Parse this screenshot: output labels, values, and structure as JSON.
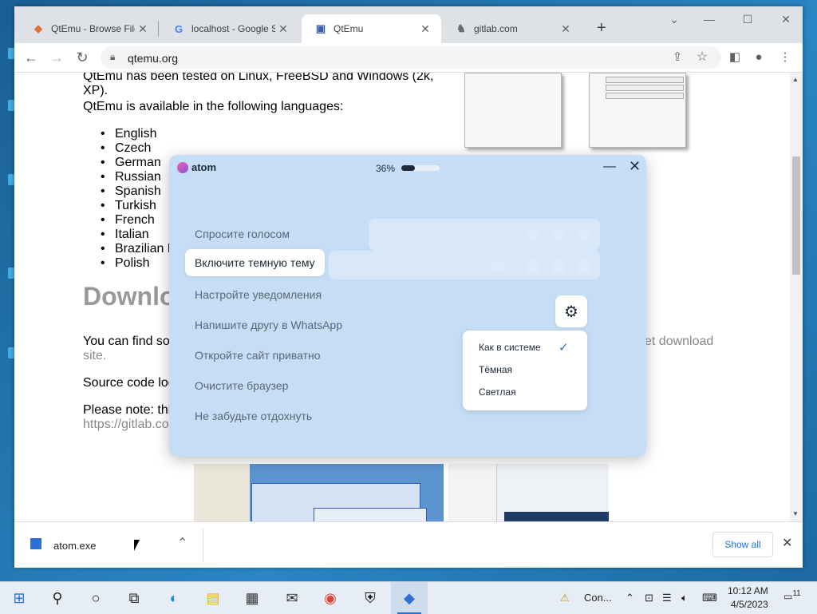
{
  "browser": {
    "tabs": [
      {
        "title": "QtEmu - Browse Files",
        "favicon": "gitlab-diamond-icon"
      },
      {
        "title": "localhost - Google Se",
        "favicon": "google-icon"
      },
      {
        "title": "QtEmu",
        "favicon": "qtemu-icon"
      },
      {
        "title": "gitlab.com",
        "favicon": "gitlab-fox-icon"
      }
    ],
    "url": "qtemu.org"
  },
  "page": {
    "line1": "QtEmu has been tested on Linux, FreeBSD and Windows (2k,",
    "line2": "XP).",
    "line3": "QtEmu is available in the following languages:",
    "languages": [
      "English",
      "Czech",
      "German",
      "Russian",
      "Spanish",
      "Turkish",
      "French",
      "Italian",
      "Brazilian P",
      "Polish"
    ],
    "heading": "Downlo",
    "para1a": "You can find so",
    "para1b": "et download",
    "para1c": "site.",
    "para2": "Source code loc",
    "para3a": "Please note: thi",
    "para3b": "https://gitlab.co"
  },
  "atom": {
    "app_name": "atom",
    "progress_label": "36%",
    "progress": 0.36,
    "suggestions": [
      "Спросите голосом",
      "Включите темную тему",
      "Настройте уведомления",
      "Напишите другу в WhatsApp",
      "Откройте сайт приватно",
      "Очистите браузер",
      "Не забудьте отдохнуть"
    ],
    "theme_menu": [
      "Как в системе",
      "Тёмная",
      "Светлая"
    ]
  },
  "download": {
    "filename": "atom.exe",
    "show_all": "Show all"
  },
  "taskbar": {
    "tray_label": "Con...",
    "time": "10:12 AM",
    "date": "4/5/2023",
    "notification_count": "11"
  }
}
